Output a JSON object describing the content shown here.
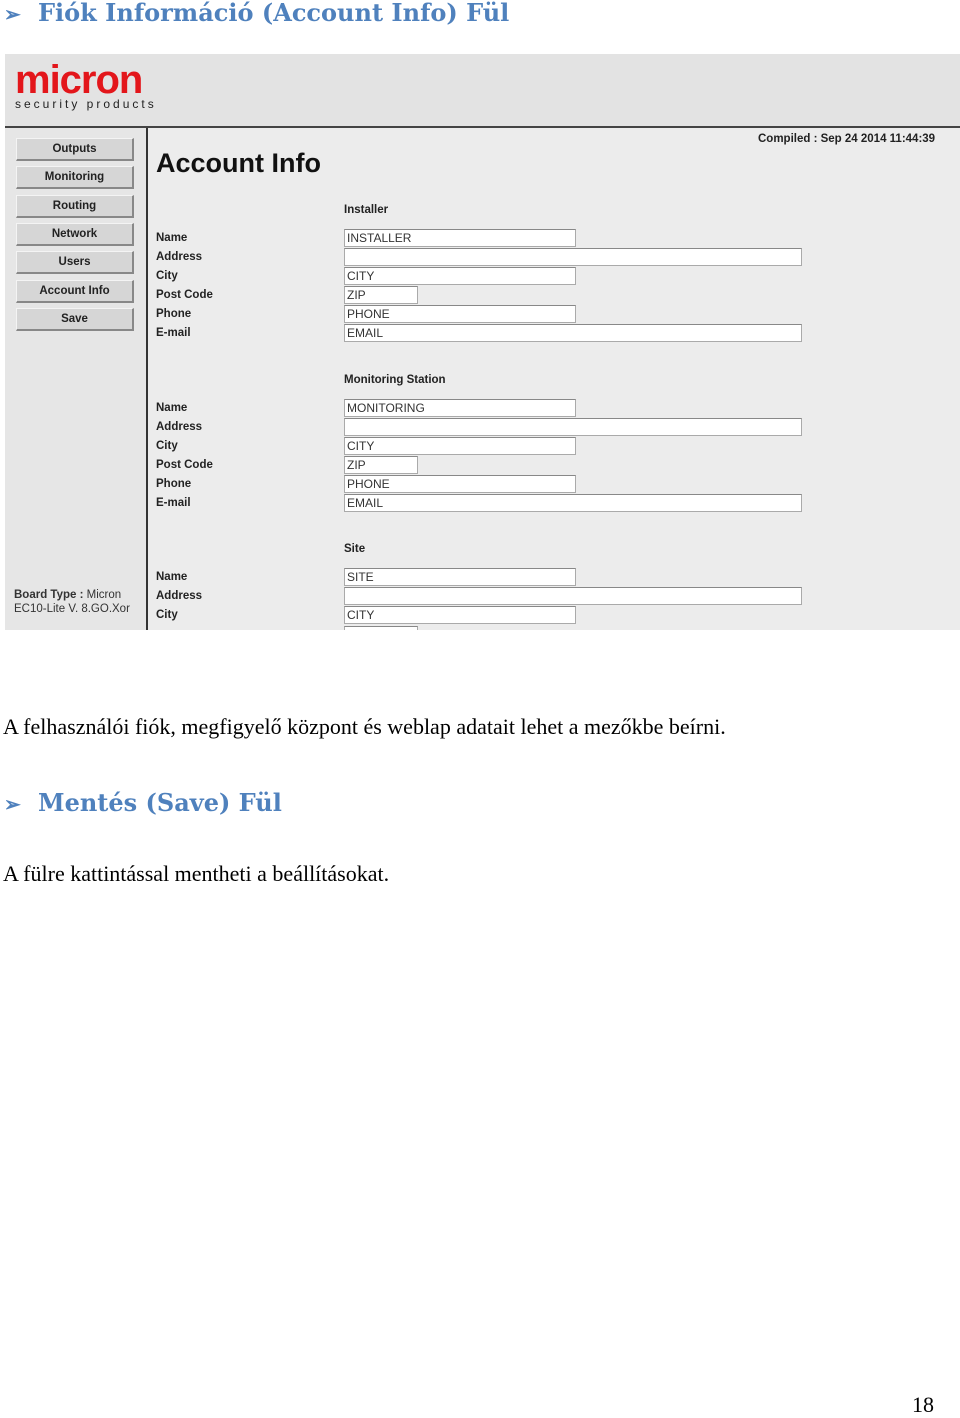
{
  "heading1": "Fiók Információ (Account Info) Fül",
  "screenshot": {
    "logo": "micron",
    "logo_sub": "security products",
    "nav": [
      "Outputs",
      "Monitoring",
      "Routing",
      "Network",
      "Users",
      "Account Info",
      "Save"
    ],
    "board_type_label": "Board Type :",
    "board_type_value": "Micron",
    "board_version": "EC10-Lite V. 8.GO.Xor",
    "title": "Account Info",
    "compiled": "Compiled : Sep 24 2014 11:44:39",
    "sections": [
      {
        "title": "Installer",
        "fields": [
          {
            "label": "Name",
            "value": "INSTALLER"
          },
          {
            "label": "Address",
            "value": ""
          },
          {
            "label": "City",
            "value": "CITY"
          },
          {
            "label": "Post Code",
            "value": "ZIP"
          },
          {
            "label": "Phone",
            "value": "PHONE"
          },
          {
            "label": "E-mail",
            "value": "EMAIL"
          }
        ]
      },
      {
        "title": "Monitoring Station",
        "fields": [
          {
            "label": "Name",
            "value": "MONITORING"
          },
          {
            "label": "Address",
            "value": ""
          },
          {
            "label": "City",
            "value": "CITY"
          },
          {
            "label": "Post Code",
            "value": "ZIP"
          },
          {
            "label": "Phone",
            "value": "PHONE"
          },
          {
            "label": "E-mail",
            "value": "EMAIL"
          }
        ]
      },
      {
        "title": "Site",
        "fields": [
          {
            "label": "Name",
            "value": "SITE"
          },
          {
            "label": "Address",
            "value": ""
          },
          {
            "label": "City",
            "value": "CITY"
          }
        ]
      }
    ]
  },
  "para1": "A felhasználói fiók, megfigyelő központ és weblap adatait lehet a mezőkbe beírni.",
  "heading2": "Mentés (Save) Fül",
  "para2": "A fülre kattintással mentheti a beállításokat.",
  "page_number": "18"
}
